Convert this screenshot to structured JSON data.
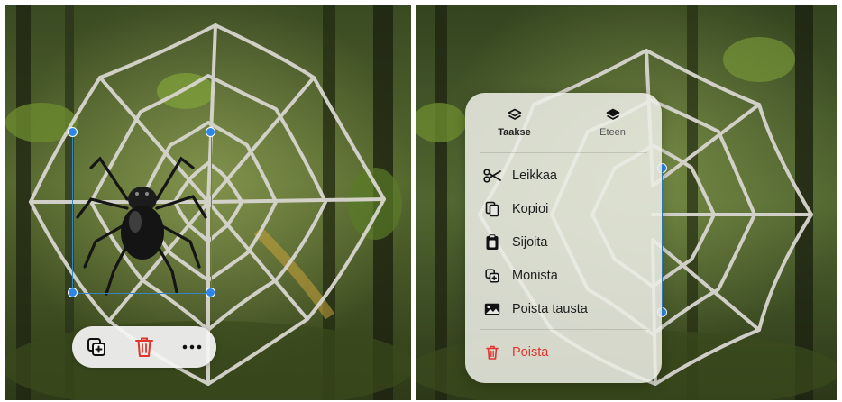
{
  "left_screen": {
    "toolbar": {
      "duplicate_icon": "duplicate-icon",
      "delete_icon": "trash-icon",
      "more_icon": "ellipsis-icon",
      "delete_color": "#e0342c"
    }
  },
  "right_screen": {
    "context_menu": {
      "layer_actions": [
        {
          "label": "Taakse",
          "icon": "layers-back-icon"
        },
        {
          "label": "Eteen",
          "icon": "layers-front-icon"
        }
      ],
      "items": [
        {
          "label": "Leikkaa",
          "icon": "scissors-icon"
        },
        {
          "label": "Kopioi",
          "icon": "copy-icon"
        },
        {
          "label": "Sijoita",
          "icon": "paste-icon"
        },
        {
          "label": "Monista",
          "icon": "duplicate-icon"
        },
        {
          "label": "Poista tausta",
          "icon": "image-icon"
        }
      ],
      "delete": {
        "label": "Poista",
        "icon": "trash-icon",
        "color": "#e0342c"
      }
    }
  }
}
